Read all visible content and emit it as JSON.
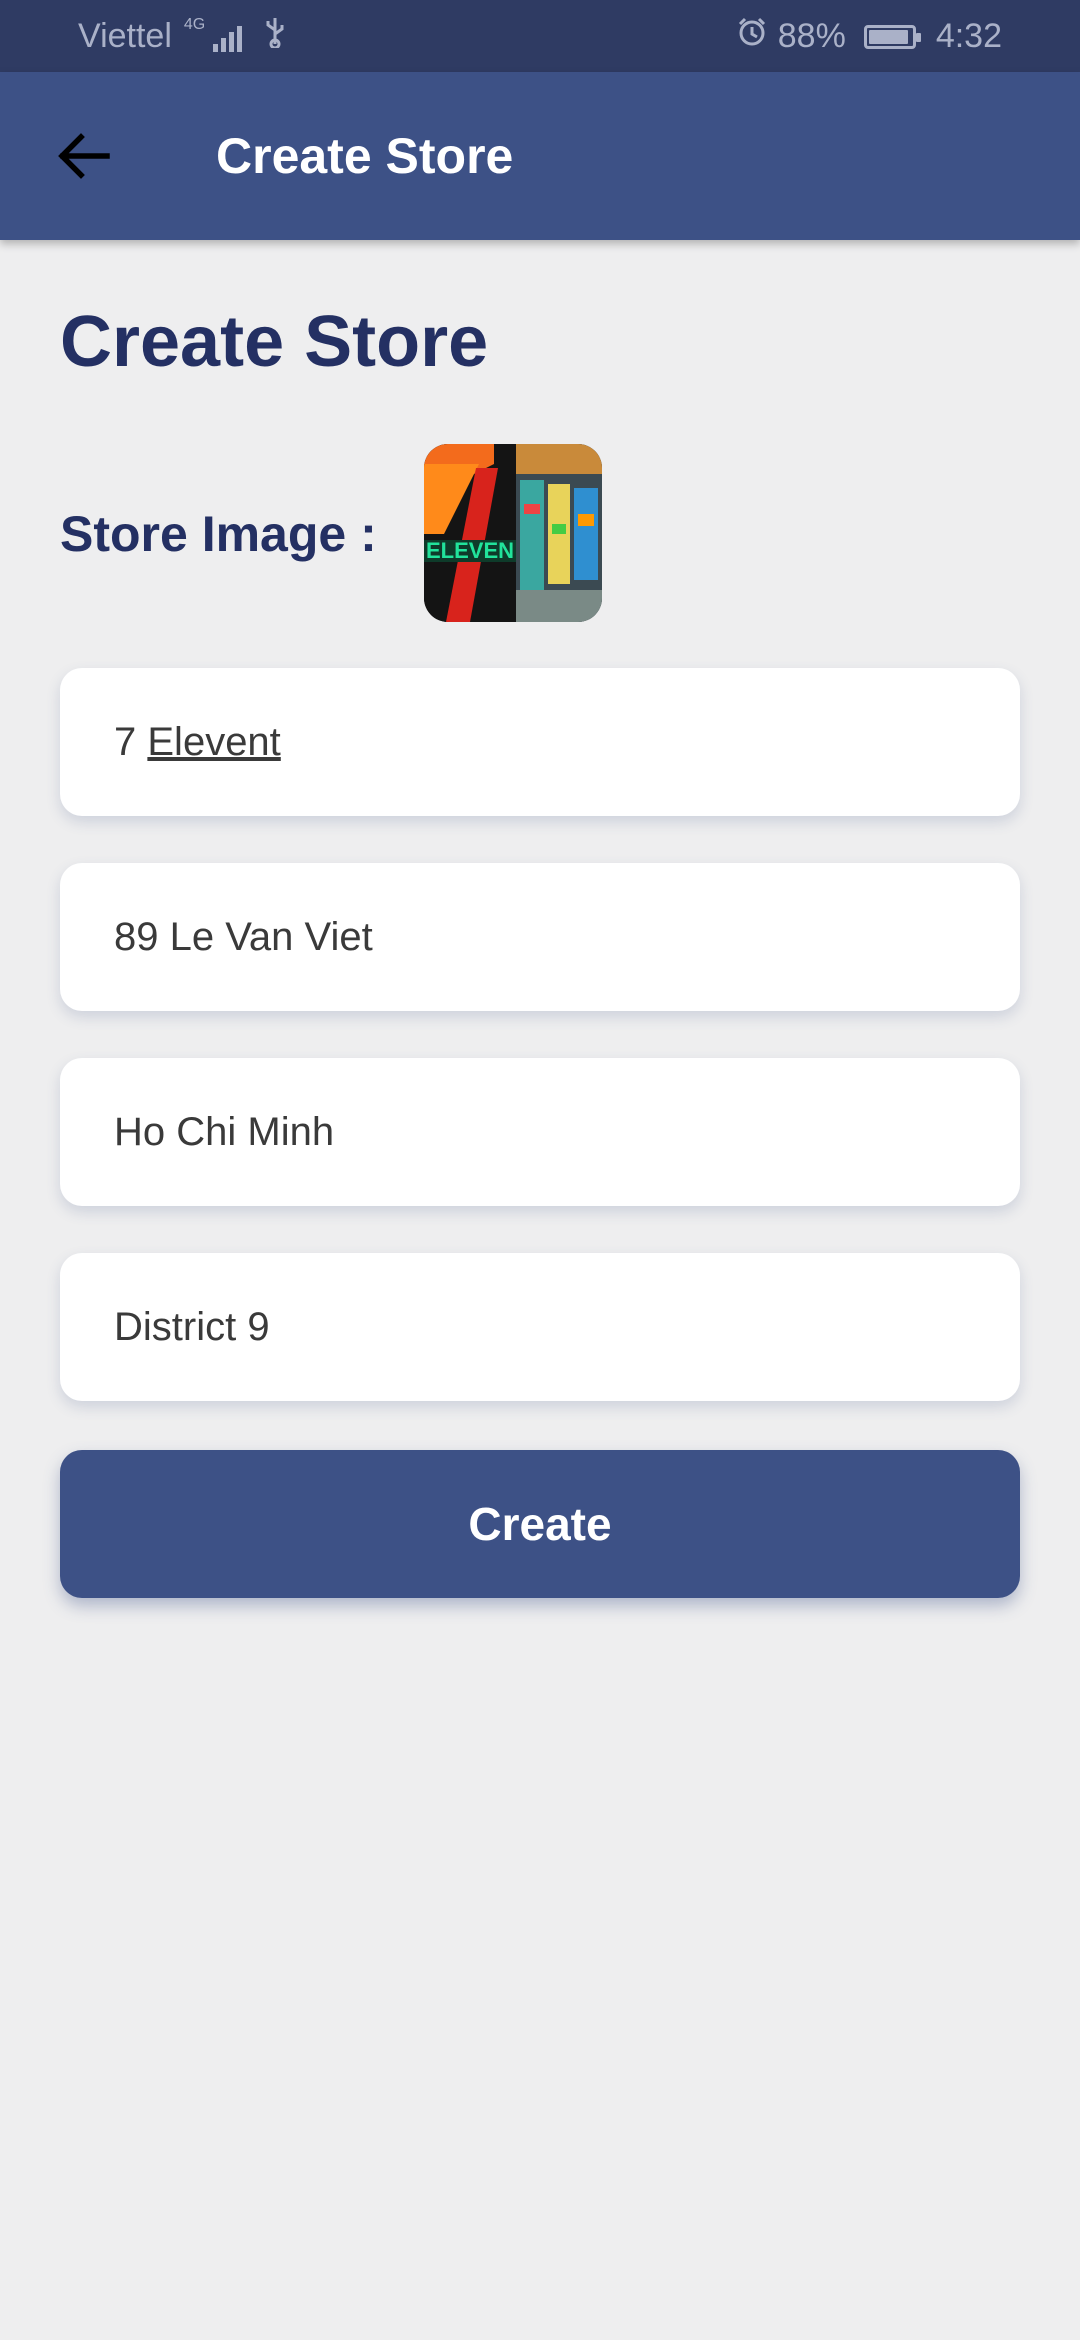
{
  "status_bar": {
    "carrier": "Viettel",
    "network": "4G",
    "battery_percent": "88%",
    "time": "4:32",
    "icons": [
      "signal-icon",
      "usb-icon",
      "alarm-icon",
      "battery-charging-icon"
    ]
  },
  "app_bar": {
    "title": "Create Store",
    "back_icon": "arrow-left-icon"
  },
  "page": {
    "title": "Create Store",
    "store_image_label": "Store Image :"
  },
  "form": {
    "store_name_prefix": "7",
    "store_name_underlined": "Elevent",
    "store_name": "7 Elevent",
    "address": "89 Le Van Viet",
    "city": "Ho Chi Minh",
    "district": "District 9"
  },
  "actions": {
    "create_label": "Create"
  },
  "colors": {
    "primary": "#3d5186",
    "status_bar": "#2f3b63",
    "title_text": "#243063",
    "background": "#eeeeef"
  }
}
